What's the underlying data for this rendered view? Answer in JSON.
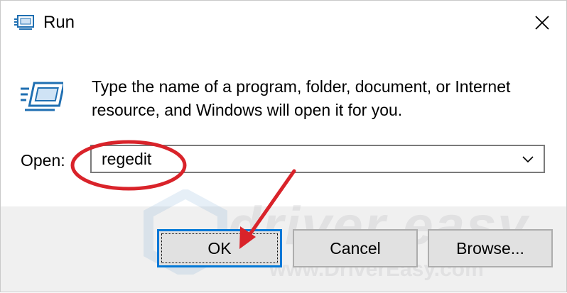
{
  "window": {
    "title": "Run",
    "close_icon": "close-icon",
    "app_icon": "run-icon"
  },
  "main": {
    "description": "Type the name of a program, folder, document, or Internet resource, and Windows will open it for you.",
    "open_label": "Open:",
    "open_value": "regedit",
    "dropdown_icon": "chevron-down-icon"
  },
  "buttons": {
    "ok": "OK",
    "cancel": "Cancel",
    "browse": "Browse..."
  },
  "watermark": {
    "logo_text": "driver easy",
    "url_text": "www.DriverEasy.com"
  },
  "annotation": {
    "color": "#d9232a"
  }
}
